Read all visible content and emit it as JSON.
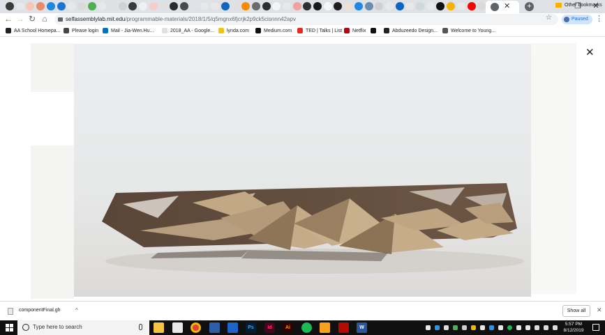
{
  "browser": {
    "url": {
      "host": "selfassemblylab.mit.edu",
      "path": "/programmable-materials/2018/1/5/q5mgnx6fjcrjk2p9ck5cisnnn42apv"
    },
    "profile_status": "Paused",
    "tab_strip": {
      "colors": [
        "#3b3b3b",
        "#e8e8e8",
        "#f7c6b4",
        "#e98a6c",
        "#1e88e5",
        "#1976d2",
        "#e8e8e8",
        "#dadada",
        "#4caf50",
        "#e8e8e8",
        "#e0e0e0",
        "#d0d0d0",
        "#3a3a3a",
        "#f0f0f0",
        "#f2d0c8",
        "#e0e0e0",
        "#2b2b2b",
        "#4a4a4a",
        "#dfe3e8",
        "#e8e8e8",
        "#e8e8e8",
        "#1565c0",
        "#e0e0e0",
        "#fb8c00",
        "#6b6b6b",
        "#2e2e2e",
        "#f4f4f4",
        "#e8e8e8",
        "#f2a0a0",
        "#303030",
        "#1a1a1a",
        "#f6f6f6",
        "#1f1f1f",
        "#f0e0d0",
        "#1e88e5",
        "#6a8caf",
        "#d0d0d0",
        "#e8e8e8",
        "#0a66c2",
        "#e8e8e8",
        "#cfd8dc",
        "#e8e8e8",
        "#111111",
        "#f4b400",
        "#e8e8e8",
        "#ff0000",
        "#dadada"
      ]
    }
  },
  "bookmarks": [
    {
      "label": "AA School Homepa...",
      "icon_color": "#222222"
    },
    {
      "label": "Please login",
      "icon_color": "#444444"
    },
    {
      "label": "Mail - Jia-Wen.Hu...",
      "icon_color": "#0072c6"
    },
    {
      "label": "2018_AA - Google...",
      "icon_color": "#e0e0e0"
    },
    {
      "label": "lynda.com",
      "icon_color": "#f1c40f"
    },
    {
      "label": "Medium.com",
      "icon_color": "#111111"
    },
    {
      "label": "TED | Talks | List",
      "icon_color": "#e62b1e"
    },
    {
      "label": "Netflix",
      "icon_color": "#b20710"
    },
    {
      "label": "",
      "icon_color": "#111111"
    },
    {
      "label": "Abduzeedo Design...",
      "icon_color": "#222222"
    },
    {
      "label": "Welcome to Young...",
      "icon_color": "#555555"
    }
  ],
  "other_bookmarks": "Other bookmarks",
  "download": {
    "filename": "componentFinal.gh",
    "show_all": "Show all"
  },
  "taskbar": {
    "search_placeholder": "Type here to search",
    "time": "5:57 PM",
    "date": "8/12/2019"
  }
}
